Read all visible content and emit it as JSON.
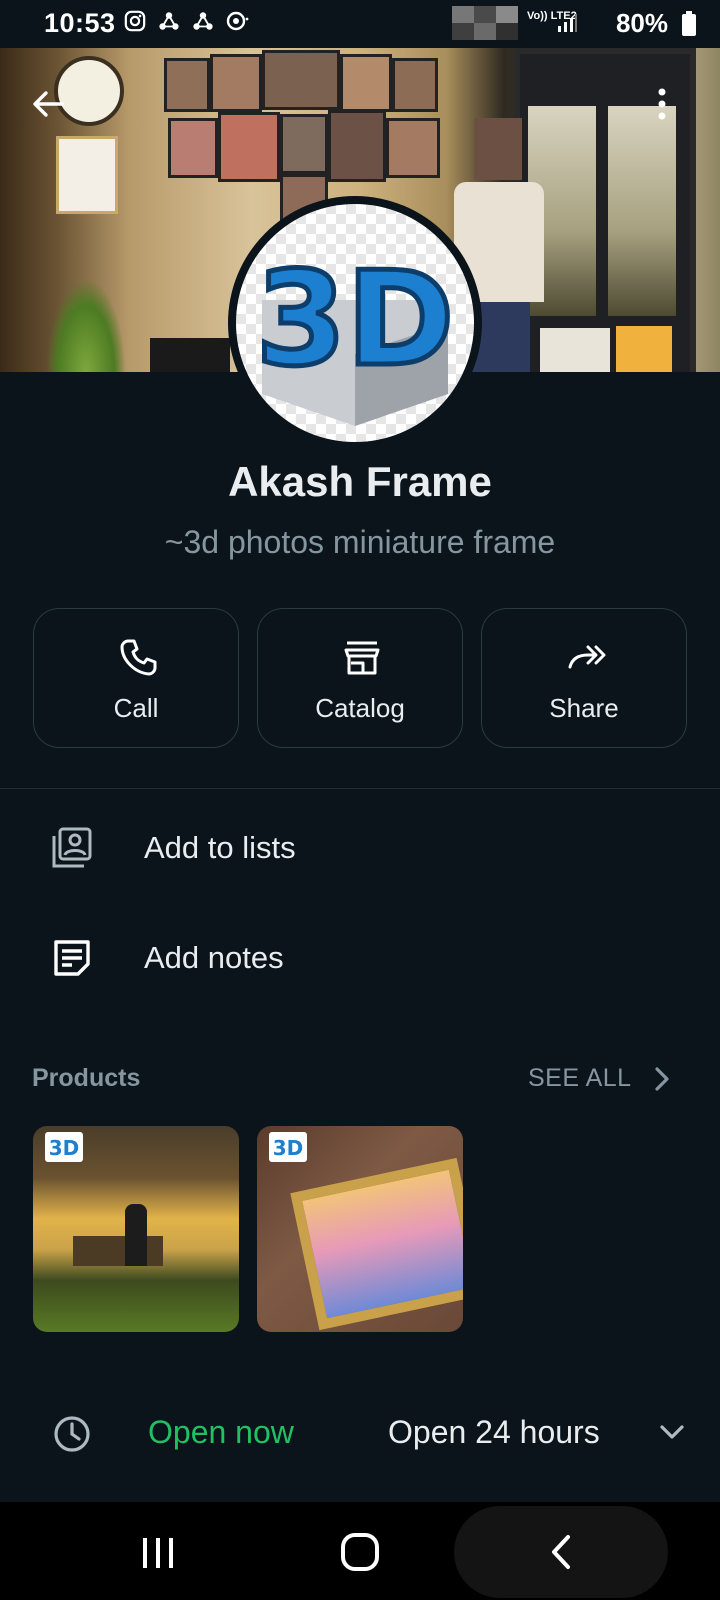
{
  "status_bar": {
    "time": "10:53",
    "network": "Vo)) LTE2",
    "battery": "80%"
  },
  "profile": {
    "name": "Akash Frame",
    "description": "~3d photos miniature frame",
    "avatar_text": "3D"
  },
  "actions": [
    {
      "label": "Call",
      "icon": "phone-icon"
    },
    {
      "label": "Catalog",
      "icon": "storefront-icon"
    },
    {
      "label": "Share",
      "icon": "forward-icon"
    }
  ],
  "menu": {
    "add_to_lists": "Add to lists",
    "add_notes": "Add notes"
  },
  "products": {
    "title": "Products",
    "see_all": "SEE ALL",
    "thumb_logo": "3D"
  },
  "hours": {
    "status": "Open now",
    "schedule": "Open 24 hours"
  },
  "colors": {
    "background": "#0b141a",
    "open_green": "#21c063",
    "muted_text": "#8696a0"
  }
}
